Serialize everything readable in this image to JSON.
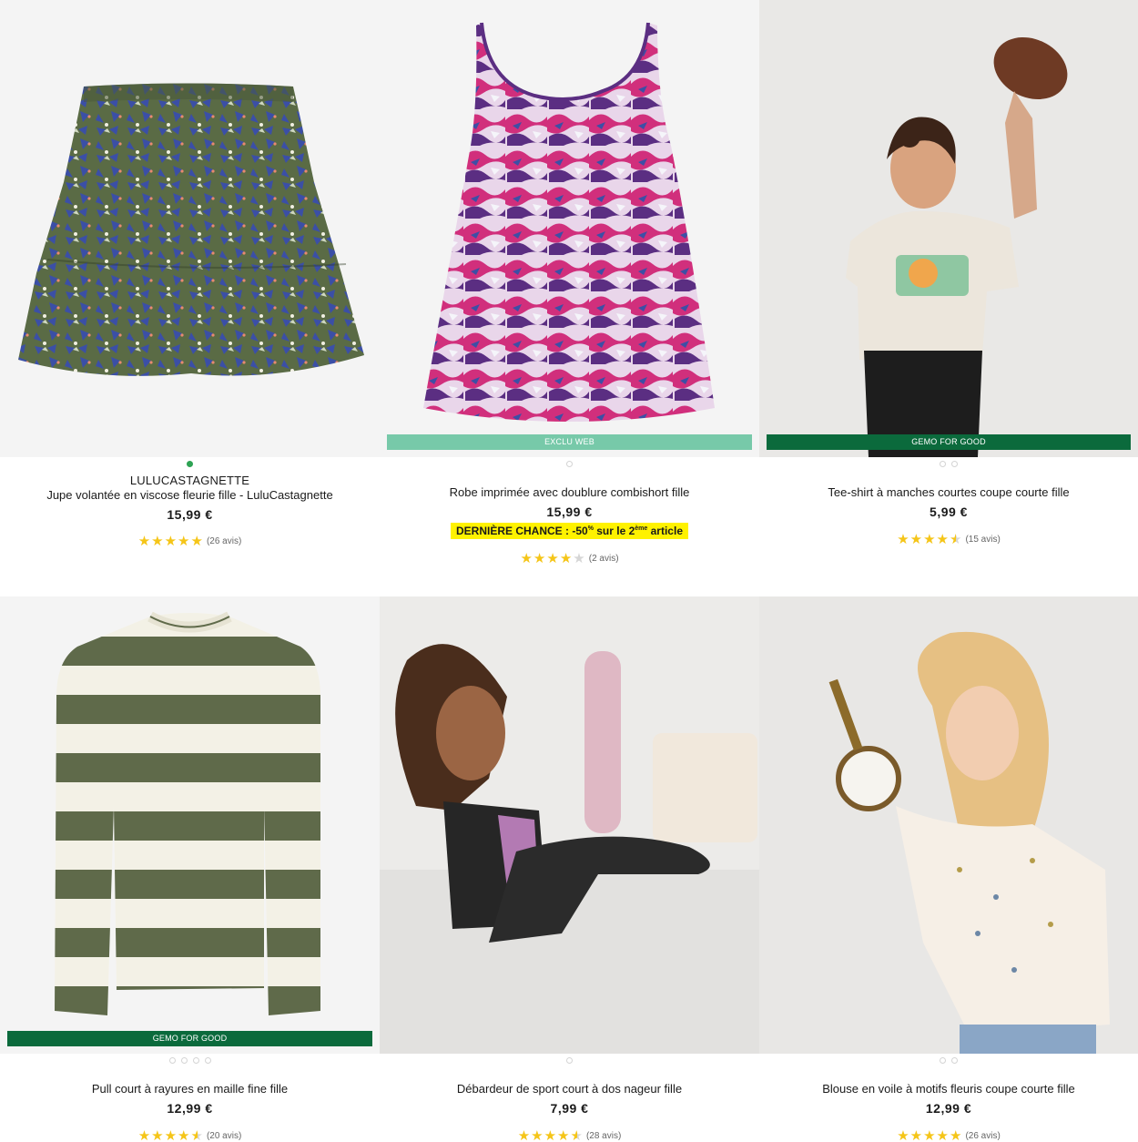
{
  "products": [
    {
      "dots": [
        "filled"
      ],
      "brand": "LULUCASTAGNETTE",
      "title": "Jupe volantée en viscose fleurie fille - LuluCastagnette",
      "price": "15,99 €",
      "rating": 5,
      "reviews": "(26 avis)",
      "colors": {
        "bg": "#f4f4f4",
        "print": "#4a5a3a",
        "accent": "#3b4fa6"
      }
    },
    {
      "badge": "EXCLU WEB",
      "dots": [
        "empty"
      ],
      "title": "Robe imprimée avec doublure combishort fille",
      "price": "15,99 €",
      "promo": {
        "label": "DERNIÈRE CHANCE :",
        "text_before": "-50",
        "sup1": "%",
        "text_mid": " sur le 2",
        "sup2": "ème",
        "text_after": " article"
      },
      "rating": 4,
      "reviews": "(2 avis)",
      "colors": {
        "print": "#d12f7c",
        "accent": "#5b2e82"
      }
    },
    {
      "badge": "GEMO FOR GOOD",
      "dots": [
        "empty",
        "empty"
      ],
      "title": "Tee-shirt à manches courtes coupe courte fille",
      "price": "5,99 €",
      "rating": 4.5,
      "reviews": "(15 avis)"
    },
    {
      "badge": "GEMO FOR GOOD",
      "dots": [
        "empty",
        "empty",
        "empty",
        "empty"
      ],
      "title": "Pull court à rayures en maille fine fille",
      "price": "12,99 €",
      "rating": 4.5,
      "reviews": "(20 avis)",
      "colors": {
        "stripe_dark": "#5f6a4a",
        "stripe_light": "#f3f1e6"
      }
    },
    {
      "dots": [
        "empty"
      ],
      "title": "Débardeur de sport court à dos nageur fille",
      "price": "7,99 €",
      "rating": 4.5,
      "reviews": "(28 avis)"
    },
    {
      "dots": [
        "empty",
        "empty"
      ],
      "title": "Blouse en voile à motifs fleuris coupe courte fille",
      "price": "12,99 €",
      "rating": 5,
      "reviews": "(26 avis)"
    }
  ]
}
